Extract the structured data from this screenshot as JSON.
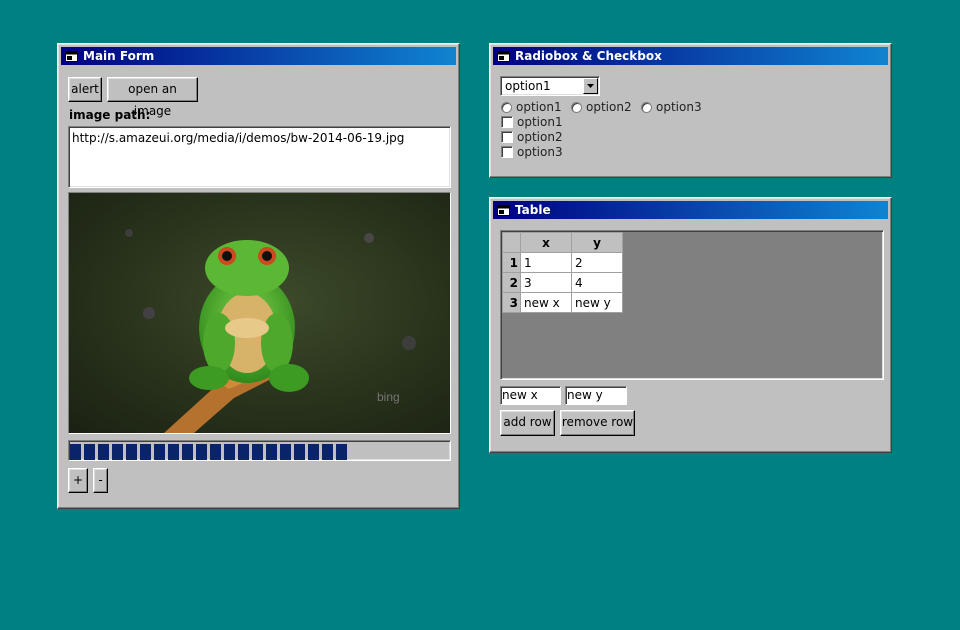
{
  "main_form": {
    "title": "Main Form",
    "alert_label": "alert",
    "open_image_label": "open an image",
    "image_path_label": "image path:",
    "image_path_value": "http://s.amazeui.org/media/i/demos/bw-2014-06-19.jpg",
    "image_watermark": "bing",
    "progress_percent": 75,
    "plus_label": "+",
    "minus_label": "-"
  },
  "radio_form": {
    "title": "Radiobox & Checkbox",
    "select_value": "option1",
    "radios": [
      "option1",
      "option2",
      "option3"
    ],
    "checkboxes": [
      "option1",
      "option2",
      "option3"
    ]
  },
  "table_form": {
    "title": "Table",
    "columns": [
      "x",
      "y"
    ],
    "rows": [
      {
        "num": "1",
        "x": "1",
        "y": "2"
      },
      {
        "num": "2",
        "x": "3",
        "y": "4"
      },
      {
        "num": "3",
        "x": "new x",
        "y": "new y"
      }
    ],
    "input_x_value": "new x",
    "input_y_value": "new y",
    "add_row_label": "add row",
    "remove_row_label": "remove row"
  },
  "colors": {
    "desktop": "#008080",
    "title_start": "#000080",
    "title_end": "#1084d0",
    "progress": "#0a246a"
  }
}
